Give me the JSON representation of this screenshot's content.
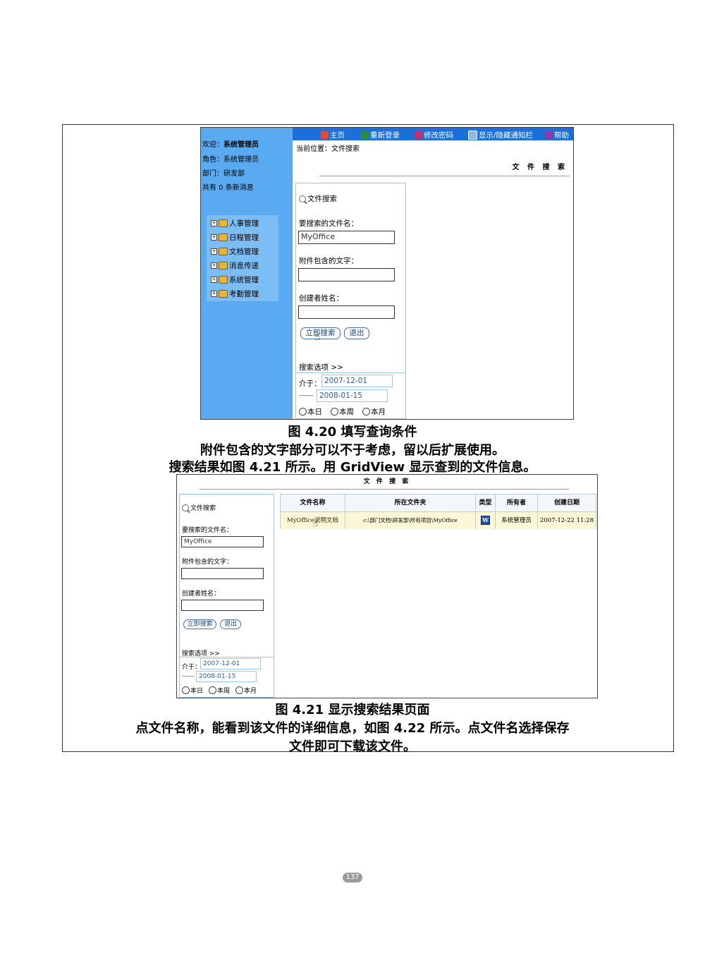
{
  "screenshot1": {
    "sidebar": {
      "welcome_label": "欢迎：",
      "welcome_user": "系统管理员",
      "role": "角色：系统管理员",
      "dept": "部门：研发部",
      "messages": "共有 0 条新消息",
      "menu": [
        "人事管理",
        "日程管理",
        "文档管理",
        "消息传递",
        "系统管理",
        "考勤管理"
      ]
    },
    "nav": [
      "主页",
      "重新登录",
      "修改密码",
      "显示/隐藏通知栏",
      "帮助"
    ],
    "breadcrumb": "当前位置：文件搜索",
    "page_title": "文 件 搜 索"
  },
  "search_form": {
    "title": "文件搜索",
    "filename_label": "要搜索的文件名：",
    "filename_value": "MyOffice",
    "attachment_label": "附件包含的文字：",
    "attachment_value": "",
    "creator_label": "创建者姓名：",
    "creator_value": "",
    "search_button": "立即搜索",
    "exit_button": "退出",
    "options_label": "搜索选项 >>",
    "between_label": "介于：",
    "date_from": "2007-12-01",
    "date_to": "2008-01-15",
    "range_sep": "-------",
    "radio_options": [
      "本日",
      "本周",
      "本月"
    ]
  },
  "captions": {
    "fig20": "图 4.20 填写查询条件",
    "line1": "附件包含的文字部分可以不于考虑，留以后扩展使用。",
    "line2": "搜索结果如图 4.21 所示。用 GridView 显示查到的文件信息。",
    "fig21": "图 4.21 显示搜索结果页面",
    "line3": "点文件名称，能看到该文件的详细信息，如图 4.22 所示。点文件名选择保存",
    "line4": "文件即可下载该文件。"
  },
  "screenshot2": {
    "page_title": "文 件 搜 索",
    "grid": {
      "headers": [
        "文件名称",
        "所在文件夹",
        "类型",
        "所有者",
        "创建日期"
      ],
      "row": {
        "name": "MyOffice说明文档",
        "folder": "c:\\部门文档\\研发部\\所有项目\\MyOffice",
        "type_icon": "W",
        "owner": "系统管理员",
        "created": "2007-12-22 11:28"
      }
    }
  },
  "page_number": "137"
}
